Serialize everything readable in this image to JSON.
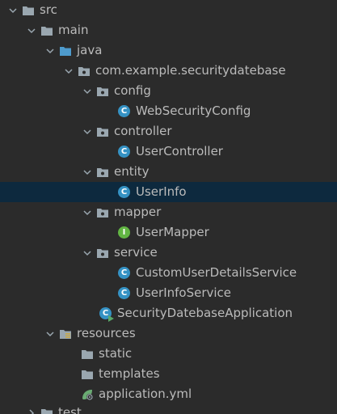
{
  "colors": {
    "background": "#2b2b2b",
    "text": "#bbbbbb",
    "selected_row": "#0d293e",
    "folder": "#9aa7b0",
    "class_badge": "#3592c4",
    "interface_badge": "#62b543"
  },
  "tree": [
    {
      "label": "src",
      "icon": "folder-icon",
      "arrow": "expanded"
    },
    {
      "label": "main",
      "icon": "folder-icon",
      "arrow": "expanded"
    },
    {
      "label": "java",
      "icon": "source-folder-icon",
      "arrow": "expanded"
    },
    {
      "label": "com.example.securitydatebase",
      "icon": "package-icon",
      "arrow": "expanded"
    },
    {
      "label": "config",
      "icon": "package-icon",
      "arrow": "expanded"
    },
    {
      "label": "WebSecurityConfig",
      "icon": "class-icon",
      "badge": "C"
    },
    {
      "label": "controller",
      "icon": "package-icon",
      "arrow": "expanded"
    },
    {
      "label": "UserController",
      "icon": "class-icon",
      "badge": "C"
    },
    {
      "label": "entity",
      "icon": "package-icon",
      "arrow": "expanded"
    },
    {
      "label": "UserInfo",
      "icon": "class-icon",
      "badge": "C",
      "selected": true
    },
    {
      "label": "mapper",
      "icon": "package-icon",
      "arrow": "expanded"
    },
    {
      "label": "UserMapper",
      "icon": "interface-icon",
      "badge": "I"
    },
    {
      "label": "service",
      "icon": "package-icon",
      "arrow": "expanded"
    },
    {
      "label": "CustomUserDetailsService",
      "icon": "class-icon",
      "badge": "C"
    },
    {
      "label": "UserInfoService",
      "icon": "class-icon",
      "badge": "C"
    },
    {
      "label": "SecurityDatebaseApplication",
      "icon": "spring-boot-class-icon",
      "badge": "C"
    },
    {
      "label": "resources",
      "icon": "resources-folder-icon",
      "arrow": "expanded"
    },
    {
      "label": "static",
      "icon": "folder-icon"
    },
    {
      "label": "templates",
      "icon": "folder-icon"
    },
    {
      "label": "application.yml",
      "icon": "spring-config-file-icon"
    },
    {
      "label": "test",
      "icon": "folder-icon",
      "arrow": "collapsed"
    }
  ]
}
